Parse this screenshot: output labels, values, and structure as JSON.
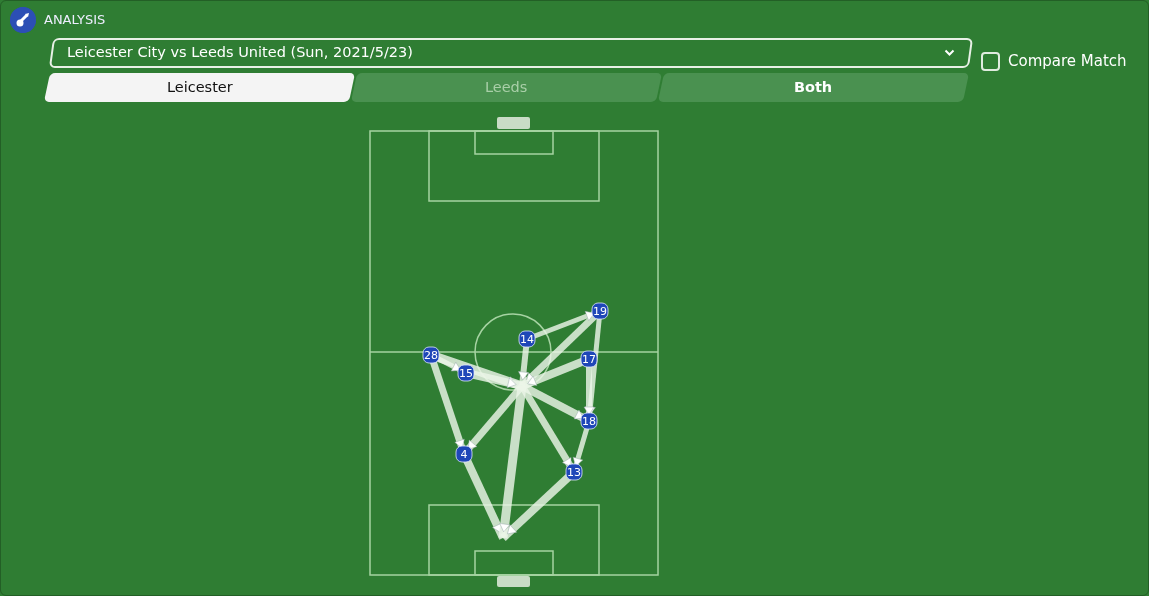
{
  "header": {
    "title": "ANALYSIS"
  },
  "match_select": {
    "value": "Leicester City vs Leeds United (Sun, 2021/5/23)"
  },
  "compare_match": {
    "label": "Compare Match",
    "checked": false
  },
  "tabs": [
    {
      "label": "Leicester",
      "selected": true,
      "disabled": false
    },
    {
      "label": "Leeds",
      "selected": false,
      "disabled": true
    },
    {
      "label": "Both",
      "selected": false,
      "disabled": false
    }
  ],
  "players": [
    {
      "number": "19"
    },
    {
      "number": "14"
    },
    {
      "number": "28"
    },
    {
      "number": "15"
    },
    {
      "number": "17"
    },
    {
      "number": "18"
    },
    {
      "number": "4"
    },
    {
      "number": "13"
    }
  ]
}
